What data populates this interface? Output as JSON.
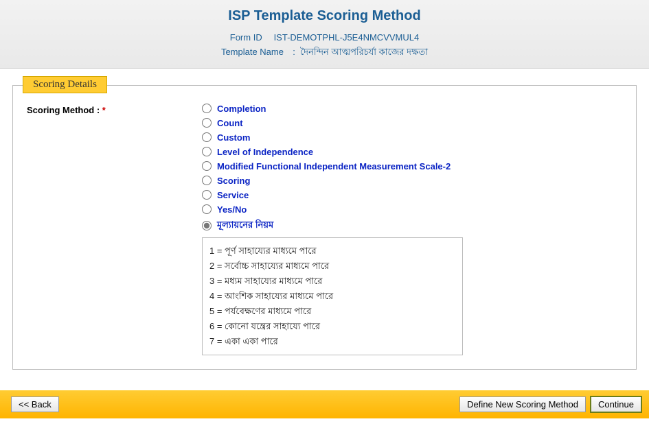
{
  "header": {
    "title": "ISP Template Scoring Method",
    "formIdLabel": "Form ID",
    "formId": "IST-DEMOTPHL-J5E4NMCVVMUL4",
    "templateNameLabel": "Template Name",
    "templateName": "দৈনন্দিন আত্মপরিচর্যা কাজের দক্ষতা"
  },
  "section": {
    "legend": "Scoring Details",
    "fieldLabel": "Scoring Method :",
    "options": [
      "Completion",
      "Count",
      "Custom",
      "Level of Independence",
      "Modified Functional Independent Measurement Scale-2",
      "Scoring",
      "Service",
      "Yes/No",
      "মূল্যায়নের নিয়ম"
    ],
    "selectedIndex": 8,
    "detailLines": [
      "1 = পূর্ণ সাহায্যের মাধ্যমে পারে",
      "2 = সর্বোচ্চ সাহায্যের মাধ্যমে পারে",
      "3 = মধ্যম সাহায্যের মাধ্যমে পারে",
      "4 = আংশিক সাহায্যের মাধ্যমে পারে",
      "5 = পর্যবেক্ষণের মাধ্যমে পারে",
      "6 = কোনো যন্ত্রের সাহায্যে পারে",
      "7 = একা একা পারে"
    ]
  },
  "footer": {
    "back": "<< Back",
    "define": "Define New Scoring Method",
    "continue": "Continue"
  }
}
